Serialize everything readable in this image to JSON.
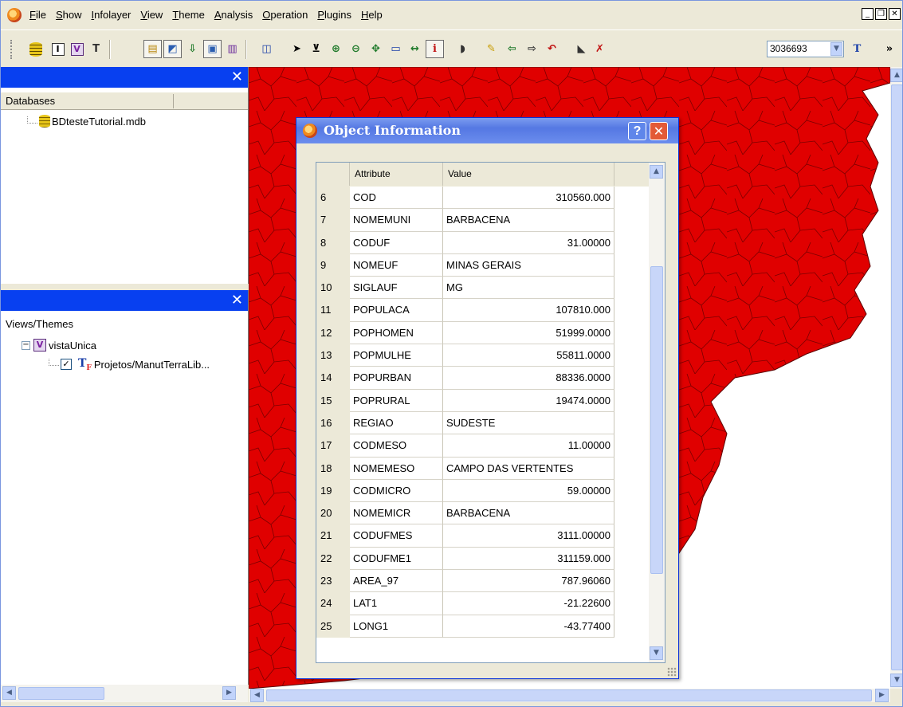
{
  "menubar": {
    "items": [
      "File",
      "Show",
      "Infolayer",
      "View",
      "Theme",
      "Analysis",
      "Operation",
      "Plugins",
      "Help"
    ]
  },
  "toolbar": {
    "scale_value": "3036693",
    "overflow_label": "»"
  },
  "databases_panel": {
    "header": "Databases",
    "items": [
      "BDtesteTutorial.mdb"
    ]
  },
  "views_panel": {
    "header": "Views/Themes",
    "view_name": "vistaUnica",
    "theme_name": "Projetos/ManutTerraLib..."
  },
  "dialog": {
    "title": "Object Information",
    "help_label": "?",
    "columns": [
      "Attribute",
      "Value"
    ],
    "rows": [
      {
        "n": "6",
        "attr": "COD",
        "value": "310560.000",
        "numeric": true
      },
      {
        "n": "7",
        "attr": "NOMEMUNI",
        "value": "BARBACENA",
        "numeric": false
      },
      {
        "n": "8",
        "attr": "CODUF",
        "value": "31.00000",
        "numeric": true
      },
      {
        "n": "9",
        "attr": "NOMEUF",
        "value": "MINAS GERAIS",
        "numeric": false
      },
      {
        "n": "10",
        "attr": "SIGLAUF",
        "value": "MG",
        "numeric": false
      },
      {
        "n": "11",
        "attr": "POPULACA",
        "value": "107810.000",
        "numeric": true
      },
      {
        "n": "12",
        "attr": "POPHOMEN",
        "value": "51999.0000",
        "numeric": true
      },
      {
        "n": "13",
        "attr": "POPMULHE",
        "value": "55811.0000",
        "numeric": true
      },
      {
        "n": "14",
        "attr": "POPURBAN",
        "value": "88336.0000",
        "numeric": true
      },
      {
        "n": "15",
        "attr": "POPRURAL",
        "value": "19474.0000",
        "numeric": true
      },
      {
        "n": "16",
        "attr": "REGIAO",
        "value": "SUDESTE",
        "numeric": false
      },
      {
        "n": "17",
        "attr": "CODMESO",
        "value": "11.00000",
        "numeric": true
      },
      {
        "n": "18",
        "attr": "NOMEMESO",
        "value": "CAMPO DAS VERTENTES",
        "numeric": false
      },
      {
        "n": "19",
        "attr": "CODMICRO",
        "value": "59.00000",
        "numeric": true
      },
      {
        "n": "20",
        "attr": "NOMEMICR",
        "value": "BARBACENA",
        "numeric": false
      },
      {
        "n": "21",
        "attr": "CODUFMES",
        "value": "3111.00000",
        "numeric": true
      },
      {
        "n": "22",
        "attr": "CODUFME1",
        "value": "311159.000",
        "numeric": true
      },
      {
        "n": "23",
        "attr": "AREA_97",
        "value": "787.96060",
        "numeric": true
      },
      {
        "n": "24",
        "attr": "LAT1",
        "value": "-21.22600",
        "numeric": true
      },
      {
        "n": "25",
        "attr": "LONG1",
        "value": "-43.77400",
        "numeric": true
      }
    ]
  },
  "colors": {
    "map_fill": "#e00000",
    "map_border": "#7a0000",
    "panel_title": "#0840f0",
    "dialog_title": "#5578e3"
  }
}
